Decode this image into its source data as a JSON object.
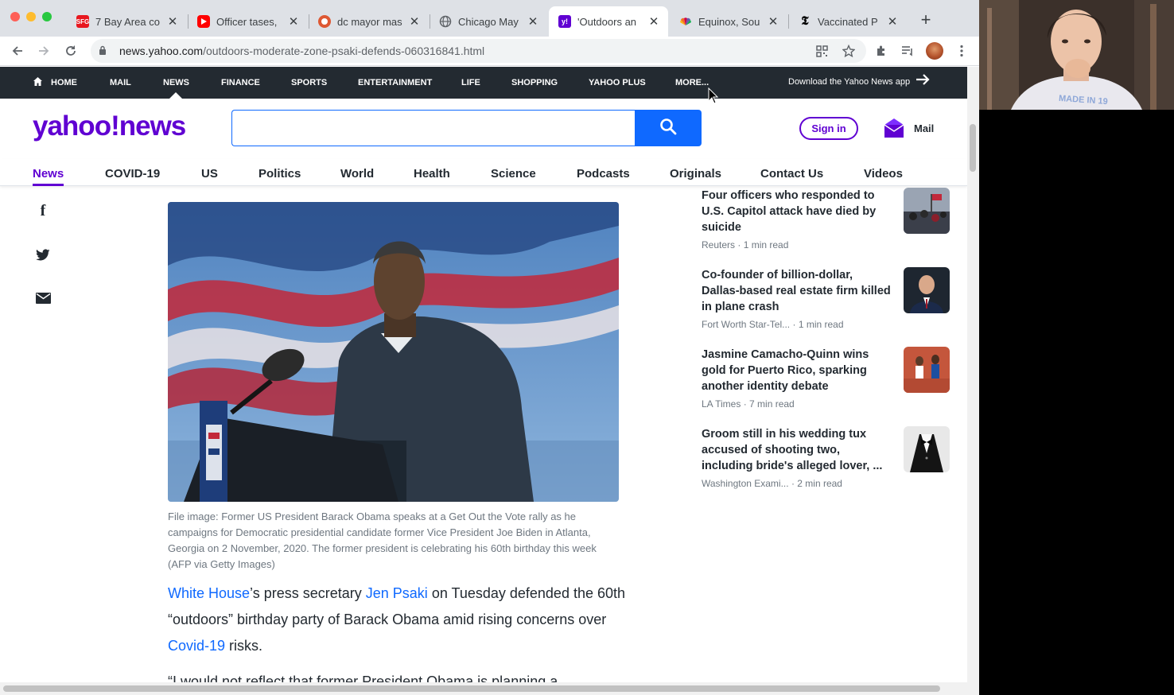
{
  "browser": {
    "tabs": [
      {
        "title": "7 Bay Area co",
        "favicon": "sfg-icon",
        "color": "#e8171f"
      },
      {
        "title": "Officer tases,",
        "favicon": "youtube-icon",
        "color": "#ff0000"
      },
      {
        "title": "dc mayor mas",
        "favicon": "search-engine-icon",
        "color": "#de5833"
      },
      {
        "title": "Chicago May",
        "favicon": "globe-icon",
        "color": "#5f6368"
      },
      {
        "title": "'Outdoors an",
        "favicon": "yahoo-icon",
        "color": "#6001d2"
      },
      {
        "title": "Equinox, Sou",
        "favicon": "nbc-icon",
        "color": "#f37021"
      },
      {
        "title": "Vaccinated P",
        "favicon": "nyt-icon",
        "color": "#000000"
      }
    ],
    "url_host": "news.yahoo.com",
    "url_path": "/outdoors-moderate-zone-psaki-defends-060316841.html"
  },
  "topnav": {
    "items": [
      "HOME",
      "MAIL",
      "NEWS",
      "FINANCE",
      "SPORTS",
      "ENTERTAINMENT",
      "LIFE",
      "SHOPPING",
      "YAHOO PLUS",
      "MORE..."
    ],
    "download_app": "Download the Yahoo News app"
  },
  "header": {
    "logo_text": "yahoo!news",
    "search_placeholder": "",
    "signin_label": "Sign in",
    "mail_label": "Mail"
  },
  "categories": {
    "items": [
      "News",
      "COVID-19",
      "US",
      "Politics",
      "World",
      "Health",
      "Science",
      "Podcasts",
      "Originals",
      "Contact Us",
      "Videos"
    ],
    "active": "News"
  },
  "article": {
    "caption": "File image: Former US President Barack Obama speaks at a Get Out the Vote rally as he campaigns for Democratic presidential candidate former Vice President Joe Biden in Atlanta, Georgia on 2 November, 2020. The former president is celebrating his 60th birthday this week (AFP via Getty Images)",
    "lede": {
      "link1": "White House",
      "text1": "’s press secretary ",
      "link2": "Jen Psaki",
      "text2": " on Tuesday defended the 60th “outdoors” birthday party of Barack Obama amid rising concerns over ",
      "link3": "Covid-19",
      "text3": " risks."
    },
    "cut_line": "“I would not reflect that former President Obama is planning a"
  },
  "sidebar": {
    "stories": [
      {
        "title": "Four officers who responded to U.S. Capitol attack have died by suicide",
        "source": "Reuters",
        "read": "1 min read"
      },
      {
        "title": "Co-founder of billion-dollar, Dallas-based real estate firm killed in plane crash",
        "source": "Fort Worth Star-Tel...",
        "read": "1 min read"
      },
      {
        "title": "Jasmine Camacho-Quinn wins gold for Puerto Rico, sparking another identity debate",
        "source": "LA Times",
        "read": "7 min read"
      },
      {
        "title": "Groom still in his wedding tux accused of shooting two, including bride's alleged lover, ...",
        "source": "Washington Exami...",
        "read": "2 min read"
      }
    ]
  },
  "colors": {
    "yahoo_purple": "#6001d2",
    "search_blue": "#0f69ff",
    "nav_dark": "#232a31",
    "link_blue": "#0f69ff"
  },
  "webcam": {
    "shirt_text": "MADE IN 19"
  }
}
